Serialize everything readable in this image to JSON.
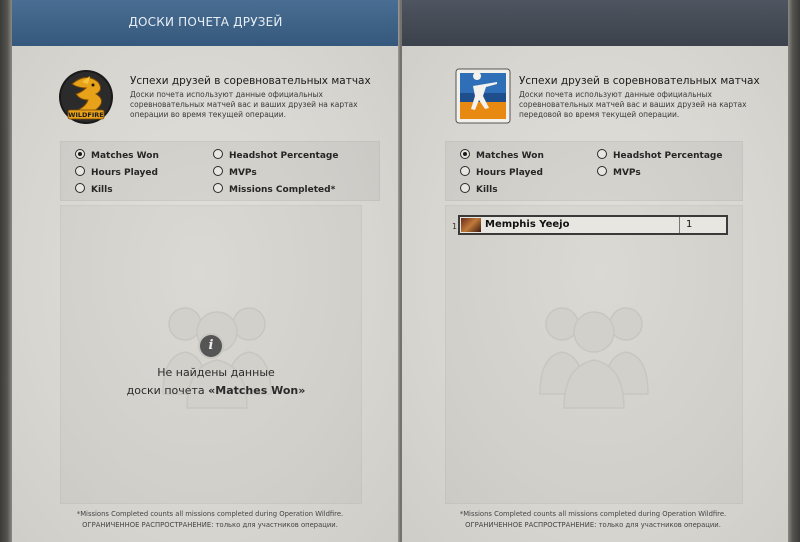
{
  "left": {
    "tab_title": "ДОСКИ ПОЧЕТА ДРУЗЕЙ",
    "header_title": "Успехи друзей в соревновательных матчах",
    "header_desc": "Доски почета используют данные официальных соревновательных матчей вас и ваших друзей на картах операции во время текущей операции.",
    "options": {
      "matches_won": "Matches Won",
      "hours_played": "Hours Played",
      "kills": "Kills",
      "headshot": "Headshot Percentage",
      "mvps": "MVPs",
      "missions": "Missions Completed*"
    },
    "nodata_line1": "Не найдены данные",
    "nodata_line2_prefix": "доски почета ",
    "nodata_line2_bold": "«Matches Won»",
    "footnote1": "*Missions Completed counts all missions completed during Operation Wildfire.",
    "footnote2": "ОГРАНИЧЕННОЕ РАСПРОСТРАНЕНИЕ: только для участников операции."
  },
  "right": {
    "header_title": "Успехи друзей в соревновательных матчах",
    "header_desc": "Доски почета используют данные официальных соревновательных матчей вас и ваших друзей на картах передовой во время текущей операции.",
    "options": {
      "matches_won": "Matches Won",
      "hours_played": "Hours Played",
      "kills": "Kills",
      "headshot": "Headshot Percentage",
      "mvps": "MVPs"
    },
    "leaderboard": [
      {
        "rank": "1",
        "name": "Memphis Yeejo",
        "score": "1"
      }
    ],
    "footnote1": "*Missions Completed counts all missions completed during Operation Wildfire.",
    "footnote2": "ОГРАНИЧЕННОЕ РАСПРОСТРАНЕНИЕ: только для участников операции."
  },
  "icons": {
    "left_logo": "wildfire-dragon-logo",
    "right_logo": "counter-strike-logo",
    "nodata": "info-icon",
    "ghost": "friends-silhouette-icon"
  },
  "colors": {
    "tab_active": "#35587c",
    "tab_inactive": "#3c424b",
    "page": "#dcdad4"
  }
}
